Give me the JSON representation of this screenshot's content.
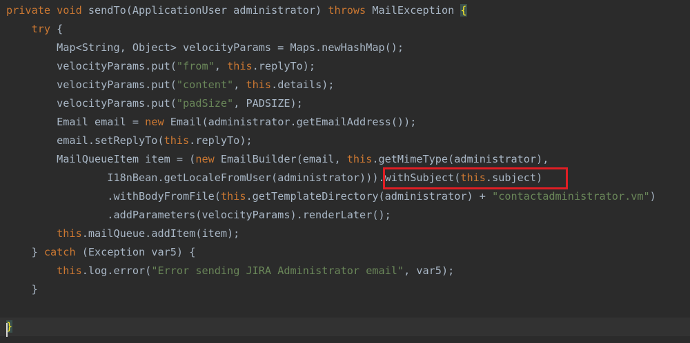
{
  "code_lines": [
    [
      {
        "t": "private void ",
        "c": "kw"
      },
      {
        "t": "sendTo(ApplicationUser administrator) ",
        "c": "pl"
      },
      {
        "t": "throws ",
        "c": "kw"
      },
      {
        "t": "MailException ",
        "c": "pl"
      },
      {
        "t": "{",
        "c": "brace-hl"
      }
    ],
    [
      {
        "t": "    try ",
        "c": "kw"
      },
      {
        "t": "{",
        "c": "pl"
      }
    ],
    [
      {
        "t": "        Map<String, Object> velocityParams = Maps.newHashMap();",
        "c": "pl"
      }
    ],
    [
      {
        "t": "        velocityParams.put(",
        "c": "pl"
      },
      {
        "t": "\"from\"",
        "c": "str"
      },
      {
        "t": ", ",
        "c": "pl"
      },
      {
        "t": "this",
        "c": "kw"
      },
      {
        "t": ".replyTo);",
        "c": "pl"
      }
    ],
    [
      {
        "t": "        velocityParams.put(",
        "c": "pl"
      },
      {
        "t": "\"content\"",
        "c": "str"
      },
      {
        "t": ", ",
        "c": "pl"
      },
      {
        "t": "this",
        "c": "kw"
      },
      {
        "t": ".details);",
        "c": "pl"
      }
    ],
    [
      {
        "t": "        velocityParams.put(",
        "c": "pl"
      },
      {
        "t": "\"padSize\"",
        "c": "str"
      },
      {
        "t": ", PADSIZE);",
        "c": "pl"
      }
    ],
    [
      {
        "t": "        Email email = ",
        "c": "pl"
      },
      {
        "t": "new ",
        "c": "kw"
      },
      {
        "t": "Email(administrator.getEmailAddress());",
        "c": "pl"
      }
    ],
    [
      {
        "t": "        email.setReplyTo(",
        "c": "pl"
      },
      {
        "t": "this",
        "c": "kw"
      },
      {
        "t": ".replyTo);",
        "c": "pl"
      }
    ],
    [
      {
        "t": "        MailQueueItem item = (",
        "c": "pl"
      },
      {
        "t": "new ",
        "c": "kw"
      },
      {
        "t": "EmailBuilder(email, ",
        "c": "pl"
      },
      {
        "t": "this",
        "c": "kw"
      },
      {
        "t": ".getMimeType(administrator),",
        "c": "pl"
      }
    ],
    [
      {
        "t": "                I18nBean.getLocaleFromUser(administrator))).withSubject(",
        "c": "pl"
      },
      {
        "t": "this",
        "c": "kw"
      },
      {
        "t": ".subject)",
        "c": "pl"
      }
    ],
    [
      {
        "t": "                .withBodyFromFile(",
        "c": "pl"
      },
      {
        "t": "this",
        "c": "kw"
      },
      {
        "t": ".getTemplateDirectory(administrator) + ",
        "c": "pl"
      },
      {
        "t": "\"contactadministrator.vm\"",
        "c": "str"
      },
      {
        "t": ")",
        "c": "pl"
      }
    ],
    [
      {
        "t": "                .addParameters(velocityParams).renderLater();",
        "c": "pl"
      }
    ],
    [
      {
        "t": "        this",
        "c": "kw"
      },
      {
        "t": ".mailQueue.addItem(item);",
        "c": "pl"
      }
    ],
    [
      {
        "t": "    } ",
        "c": "pl"
      },
      {
        "t": "catch ",
        "c": "kw"
      },
      {
        "t": "(Exception var5) {",
        "c": "pl"
      }
    ],
    [
      {
        "t": "        this",
        "c": "kw"
      },
      {
        "t": ".log.error(",
        "c": "pl"
      },
      {
        "t": "\"Error sending JIRA Administrator email\"",
        "c": "str"
      },
      {
        "t": ", var5);",
        "c": "pl"
      }
    ],
    [
      {
        "t": "    }",
        "c": "pl"
      }
    ],
    [],
    [
      {
        "t": "}",
        "c": "brace-hl"
      }
    ]
  ],
  "current_line_index": 17,
  "highlighted_text": ".withSubject(this.subject)",
  "colors": {
    "background": "#2b2b2b",
    "keyword": "#cc7832",
    "string": "#6a8759",
    "plain": "#a9b7c6",
    "annotation_box": "#e01e24"
  }
}
